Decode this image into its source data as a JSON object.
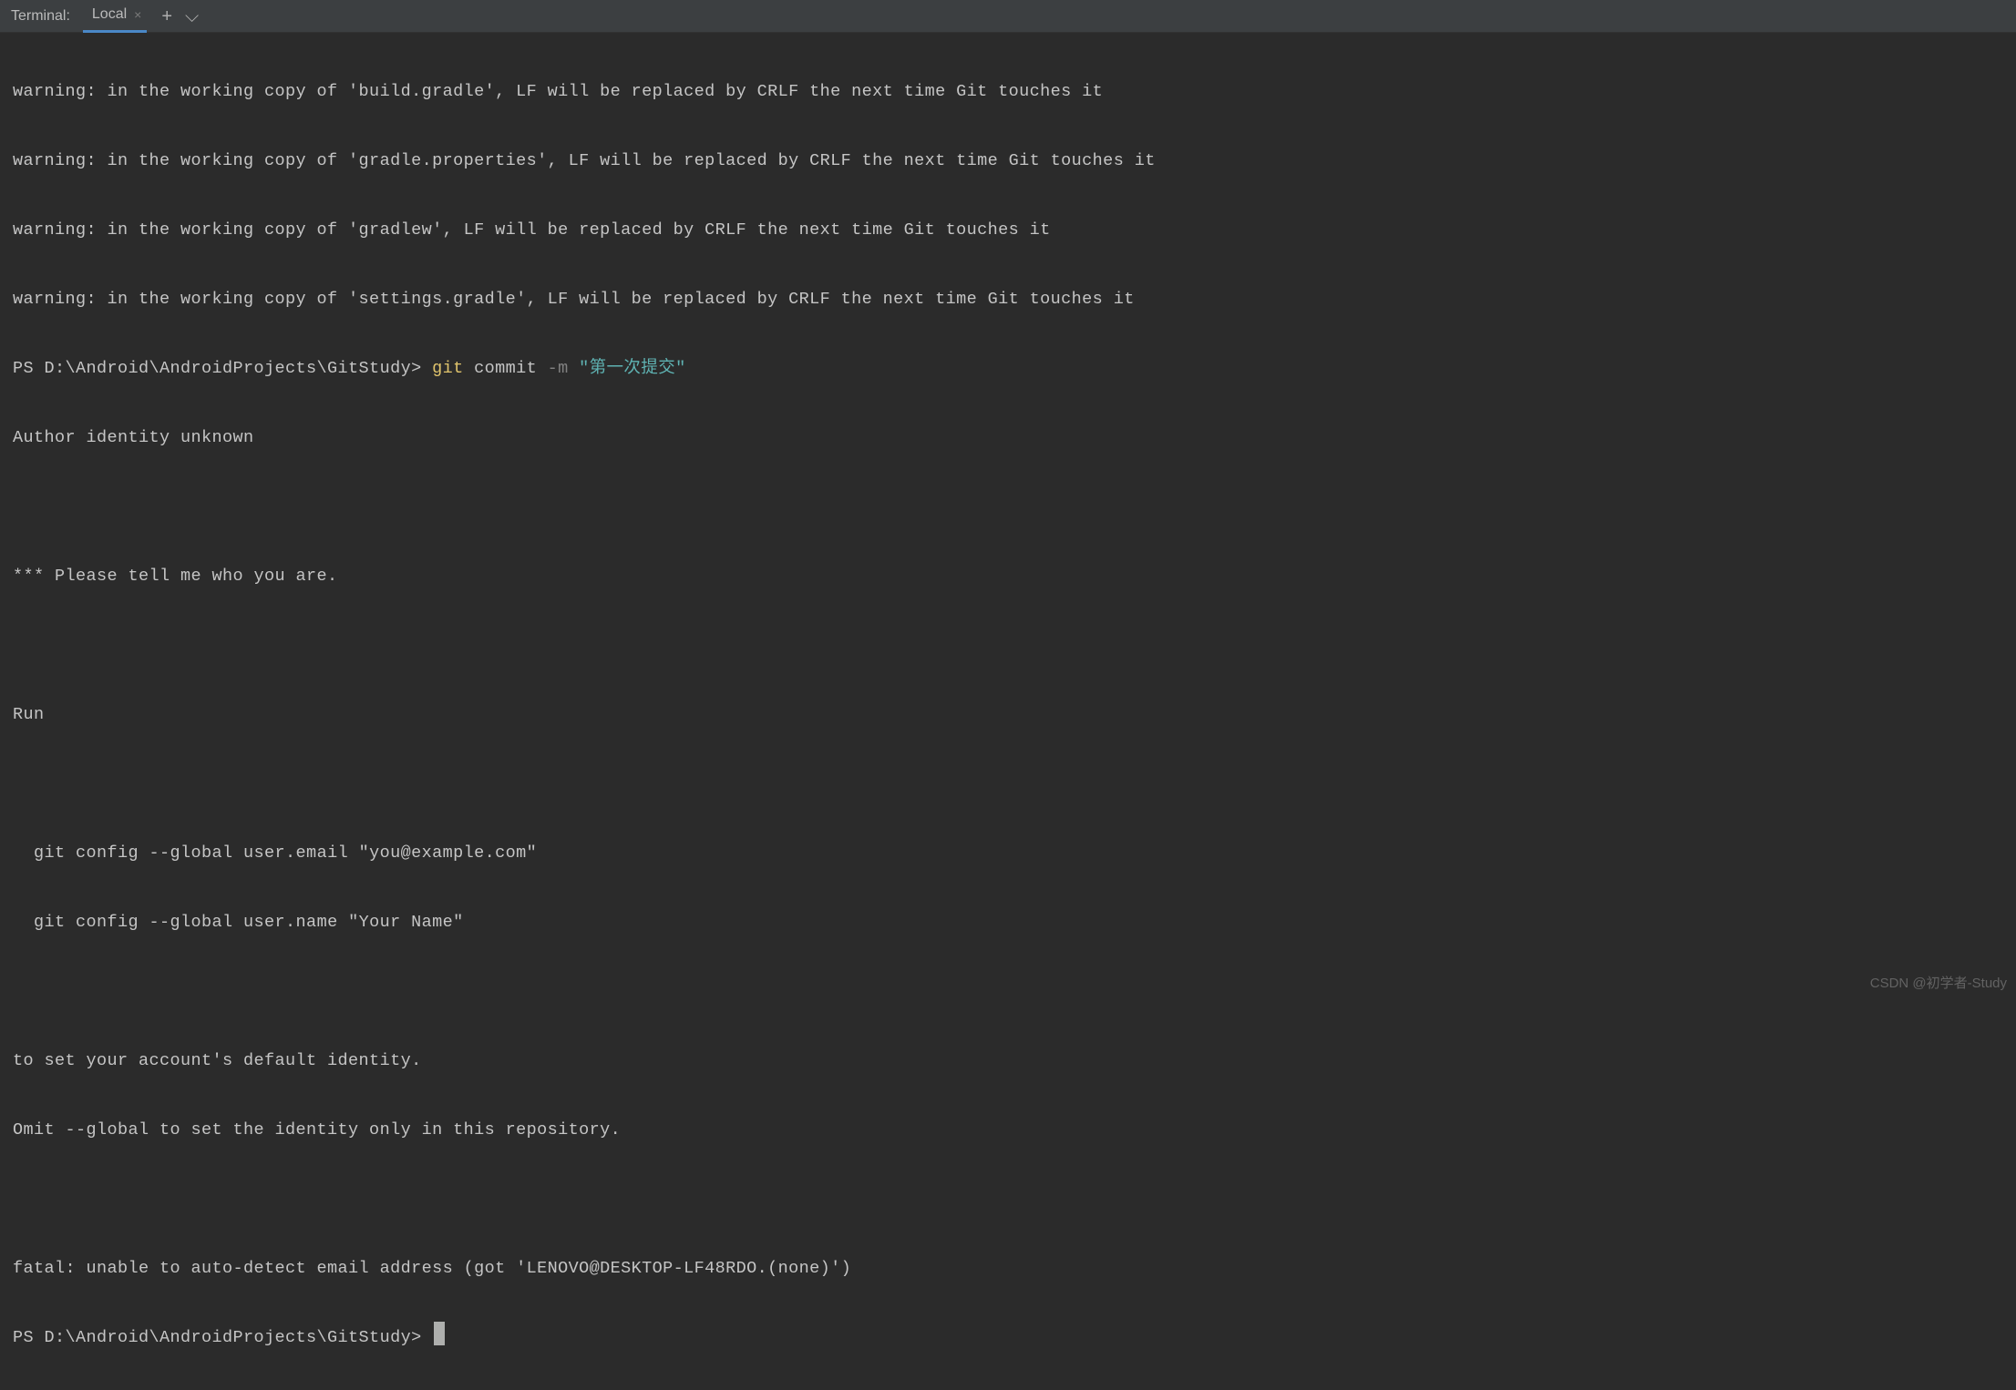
{
  "header": {
    "title": "Terminal:",
    "tab": {
      "label": "Local",
      "close_glyph": "×"
    },
    "add_glyph": "+",
    "chevron_glyph": "⌵"
  },
  "terminal": {
    "lines": {
      "warn1": "warning: in the working copy of 'build.gradle', LF will be replaced by CRLF the next time Git touches it",
      "warn2": "warning: in the working copy of 'gradle.properties', LF will be replaced by CRLF the next time Git touches it",
      "warn3": "warning: in the working copy of 'gradlew', LF will be replaced by CRLF the next time Git touches it",
      "warn4": "warning: in the working copy of 'settings.gradle', LF will be replaced by CRLF the next time Git touches it",
      "prompt1_path": "PS D:\\Android\\AndroidProjects\\GitStudy> ",
      "cmd_git": "git",
      "cmd_commit": " commit ",
      "cmd_flag": "-m ",
      "cmd_msg": "\"第一次提交\"",
      "author_unknown": "Author identity unknown",
      "blank": " ",
      "please_tell": "*** Please tell me who you are.",
      "run": "Run",
      "config_email": "  git config --global user.email \"you@example.com\"",
      "config_name": "  git config --global user.name \"Your Name\"",
      "to_set": "to set your account's default identity.",
      "omit": "Omit --global to set the identity only in this repository.",
      "fatal": "fatal: unable to auto-detect email address (got 'LENOVO@DESKTOP-LF48RDO.(none)')",
      "prompt2_path": "PS D:\\Android\\AndroidProjects\\GitStudy> "
    }
  },
  "watermark": "CSDN @初学者-Study"
}
